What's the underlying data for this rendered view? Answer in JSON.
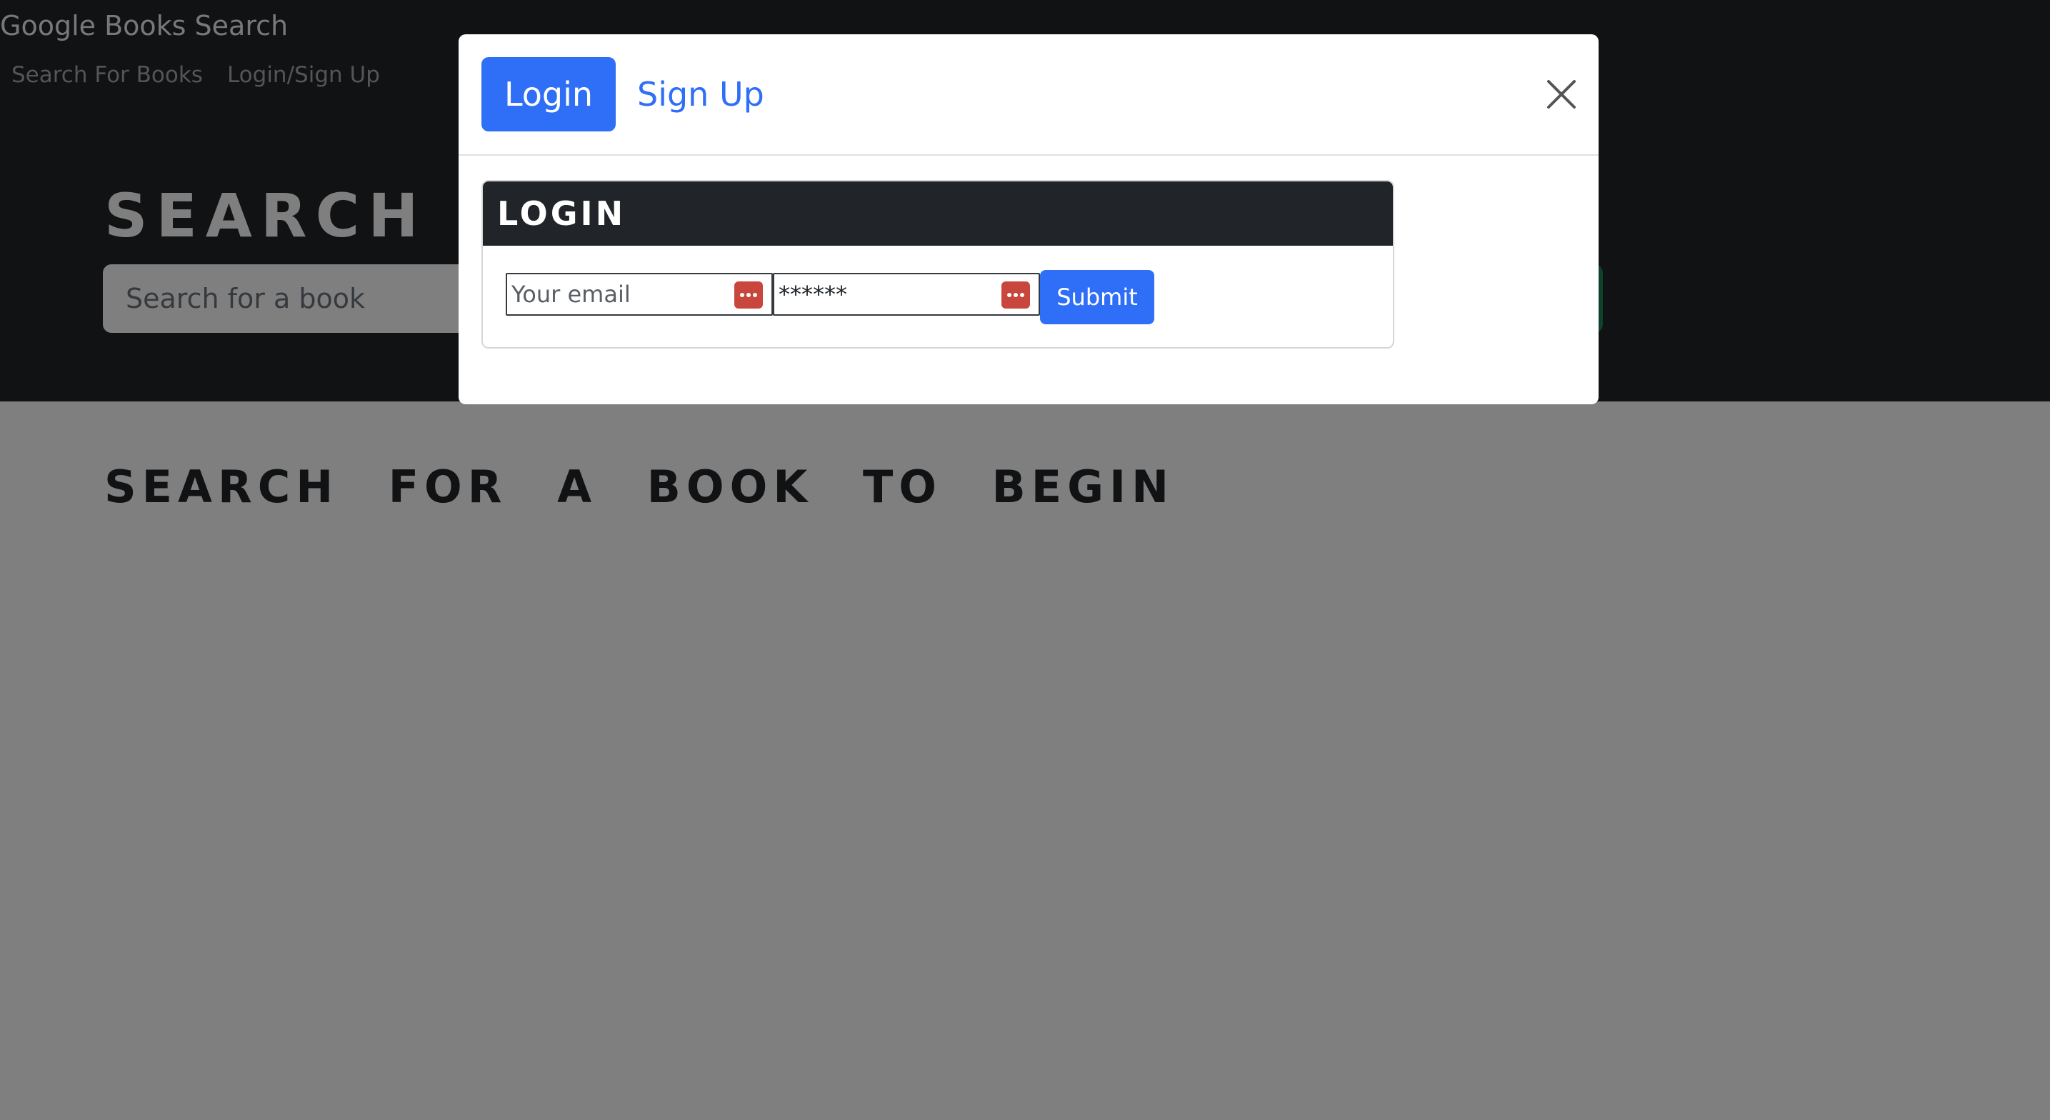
{
  "navbar": {
    "brand": "Google Books Search",
    "links": [
      {
        "label": "Search For Books"
      },
      {
        "label": "Login/Sign Up"
      }
    ]
  },
  "hero": {
    "title": "SEARCH FOR BOOKS!",
    "search_placeholder": "Search for a book"
  },
  "main": {
    "results_title": "SEARCH FOR A BOOK TO BEGIN"
  },
  "modal": {
    "tabs": [
      {
        "label": "Login",
        "active": true
      },
      {
        "label": "Sign Up",
        "active": false
      }
    ],
    "card_title": "LOGIN",
    "email_placeholder": "Your email",
    "password_value": "******",
    "submit_label": "Submit"
  },
  "colors": {
    "primary": "#2f6ef7",
    "dark": "#212529",
    "password_manager_icon": "#c9463d"
  }
}
